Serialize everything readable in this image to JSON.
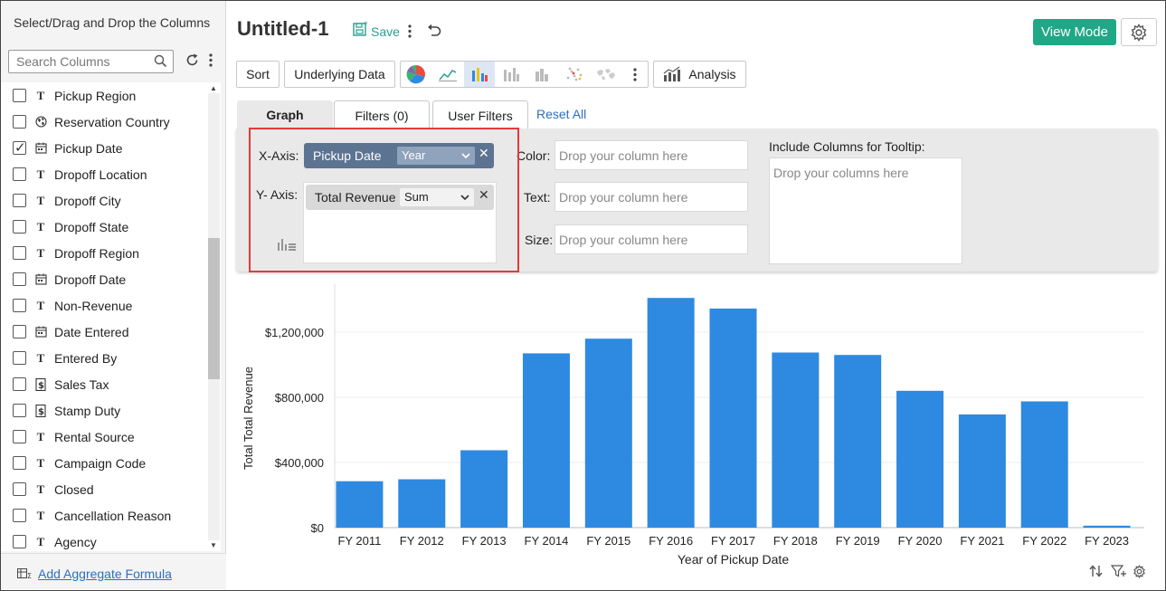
{
  "sidebar": {
    "title": "Select/Drag and Drop the Columns",
    "search_placeholder": "Search Columns",
    "items": [
      {
        "label": "Pickup Region",
        "type": "text",
        "checked": false
      },
      {
        "label": "Reservation Country",
        "type": "geo",
        "checked": false
      },
      {
        "label": "Pickup Date",
        "type": "date",
        "checked": true
      },
      {
        "label": "Dropoff Location",
        "type": "text",
        "checked": false
      },
      {
        "label": "Dropoff City",
        "type": "text",
        "checked": false
      },
      {
        "label": "Dropoff State",
        "type": "text",
        "checked": false
      },
      {
        "label": "Dropoff Region",
        "type": "text",
        "checked": false
      },
      {
        "label": "Dropoff Date",
        "type": "date",
        "checked": false
      },
      {
        "label": "Non-Revenue",
        "type": "text",
        "checked": false
      },
      {
        "label": "Date Entered",
        "type": "date",
        "checked": false
      },
      {
        "label": "Entered By",
        "type": "text",
        "checked": false
      },
      {
        "label": "Sales Tax",
        "type": "currency",
        "checked": false
      },
      {
        "label": "Stamp Duty",
        "type": "currency",
        "checked": false
      },
      {
        "label": "Rental Source",
        "type": "text",
        "checked": false
      },
      {
        "label": "Campaign Code",
        "type": "text",
        "checked": false
      },
      {
        "label": "Closed",
        "type": "text",
        "checked": false
      },
      {
        "label": "Cancellation Reason",
        "type": "text",
        "checked": false
      },
      {
        "label": "Agency",
        "type": "text",
        "checked": false
      }
    ],
    "footer_link": "Add Aggregate Formula"
  },
  "header": {
    "title": "Untitled-1",
    "save_label": "Save",
    "view_mode_label": "View Mode"
  },
  "toolbar": {
    "sort_label": "Sort",
    "underlying_label": "Underlying Data",
    "analysis_label": "Analysis"
  },
  "tabs": {
    "graph": "Graph",
    "filters": "Filters  (0)",
    "user_filters": "User Filters",
    "reset_all": "Reset All"
  },
  "config": {
    "x_axis_label": "X-Axis:",
    "y_axis_label": "Y- Axis:",
    "x_column": "Pickup Date",
    "x_agg": "Year",
    "y_column": "Total Revenue",
    "y_agg": "Sum",
    "color_label": "Color:",
    "text_label": "Text:",
    "size_label": "Size:",
    "drop_placeholder": "Drop your column here",
    "tooltip_label": "Include Columns for Tooltip:",
    "tooltip_placeholder": "Drop your columns here"
  },
  "colors": {
    "accent": "#20a886",
    "bar": "#2e8ae0",
    "pill_dark": "#5c7391",
    "highlight": "#e23b3b",
    "link": "#2a6fbf"
  },
  "chart_data": {
    "type": "bar",
    "categories": [
      "FY 2011",
      "FY 2012",
      "FY 2013",
      "FY 2014",
      "FY 2015",
      "FY 2016",
      "FY 2017",
      "FY 2018",
      "FY 2019",
      "FY 2020",
      "FY 2021",
      "FY 2022",
      "FY 2023"
    ],
    "values": [
      285000,
      297000,
      475000,
      1070000,
      1160000,
      1410000,
      1345000,
      1075000,
      1060000,
      840000,
      695000,
      775000,
      12000
    ],
    "xlabel": "Year of Pickup Date",
    "ylabel": "Total Total Revenue",
    "ylim": [
      0,
      1400000
    ],
    "yticks": [
      0,
      400000,
      800000,
      1200000
    ],
    "ytick_labels": [
      "$0",
      "$400,000",
      "$800,000",
      "$1,200,000"
    ],
    "grid": true
  }
}
